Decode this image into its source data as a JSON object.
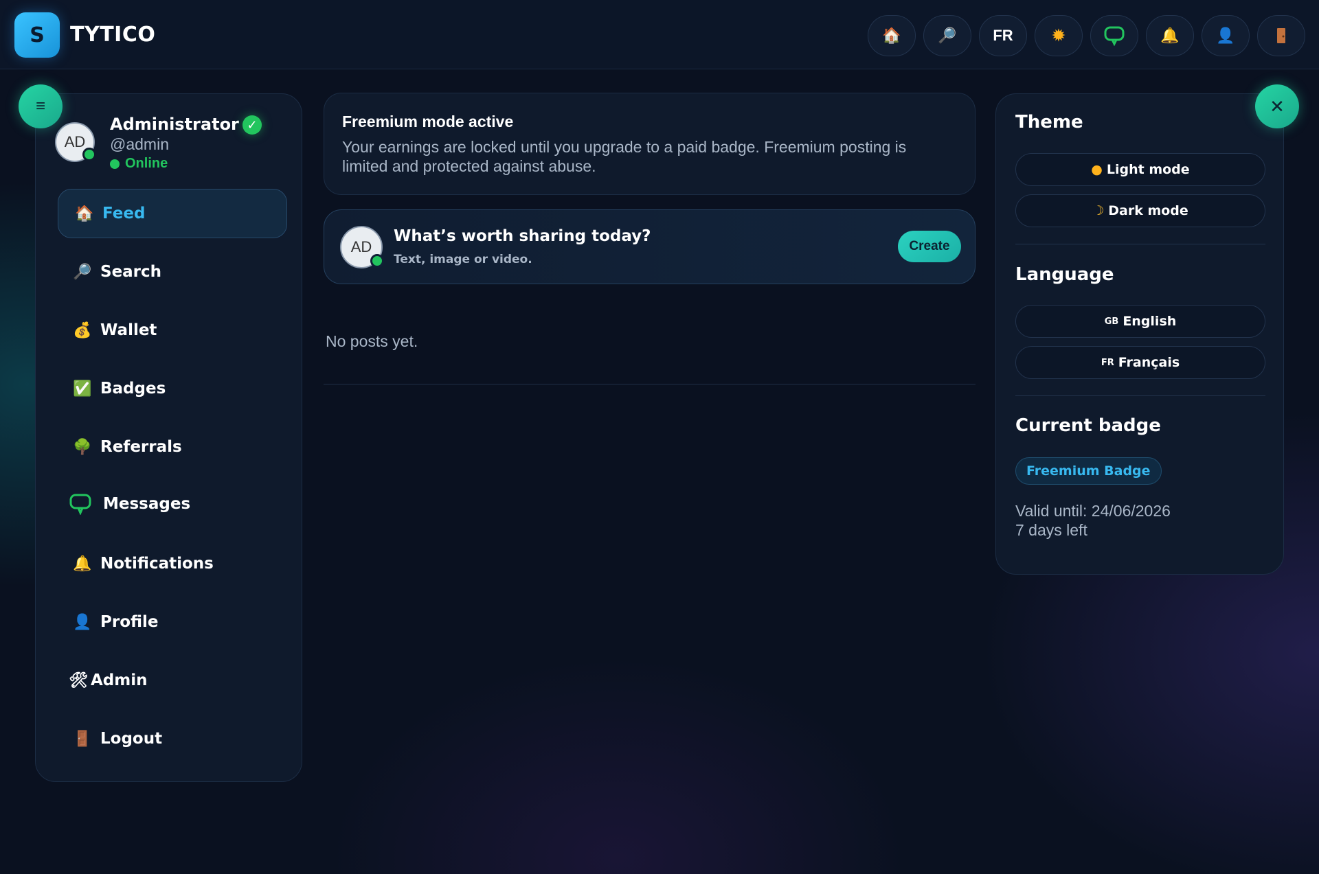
{
  "brand": {
    "logo_letter": "S",
    "name": "TYTICO"
  },
  "topbar": {
    "language_button": "FR",
    "icons": [
      "home-icon",
      "search-icon",
      "sun-icon",
      "chat-icon",
      "bell-icon",
      "profile-icon",
      "door-icon"
    ]
  },
  "sidebar": {
    "avatar_initials": "AD",
    "name": "Administrator",
    "handle": "@admin",
    "status": "Online",
    "items": [
      {
        "label": "Feed",
        "icon": "🏠"
      },
      {
        "label": "Search",
        "icon": "🔎"
      },
      {
        "label": "Wallet",
        "icon": "💰"
      },
      {
        "label": "Badges",
        "icon": "✅"
      },
      {
        "label": "Referrals",
        "icon": "🌳"
      },
      {
        "label": "Messages",
        "icon": "💬"
      },
      {
        "label": "Notifications",
        "icon": "🔔"
      },
      {
        "label": "Profile",
        "icon": "👤"
      },
      {
        "label": "Admin",
        "icon": "🛠"
      },
      {
        "label": "Logout",
        "icon": "🚪"
      }
    ]
  },
  "notice": {
    "title": "Freemium mode active",
    "text": "Your earnings are locked until you upgrade to a paid badge. Freemium posting is limited and protected against abuse."
  },
  "composer": {
    "avatar_initials": "AD",
    "title": "What’s worth sharing today?",
    "subtitle": "Text, image or video.",
    "create_label": "Create"
  },
  "feed": {
    "empty_text": "No posts yet."
  },
  "panel": {
    "theme_title": "Theme",
    "light_mode": "Light mode",
    "dark_mode": "Dark mode",
    "language_title": "Language",
    "english_flag": "GB",
    "english": "English",
    "french_flag": "FR",
    "french": "Français",
    "badge_title": "Current badge",
    "badge_name": "Freemium Badge",
    "valid_until": "Valid until: 24/06/2026",
    "days_left": "7 days left"
  },
  "colors": {
    "accent": "#38b9f0",
    "online": "#22c55e",
    "teal": "#25d4a3",
    "background": "#0a1120"
  }
}
